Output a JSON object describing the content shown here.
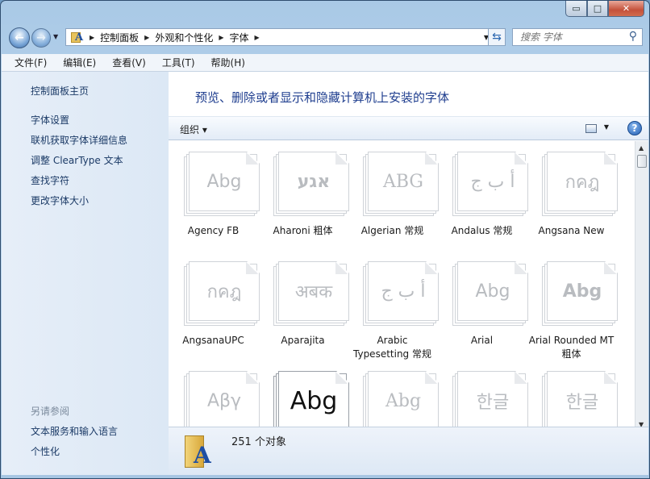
{
  "window": {
    "min_label": "▭",
    "max_label": "□",
    "close_label": "✕"
  },
  "address": {
    "crumbs": [
      "控制面板",
      "外观和个性化",
      "字体"
    ],
    "search_placeholder": "搜索 字体"
  },
  "menu": [
    "文件(F)",
    "编辑(E)",
    "查看(V)",
    "工具(T)",
    "帮助(H)"
  ],
  "sidebar": {
    "home": "控制面板主页",
    "links": [
      "字体设置",
      "联机获取字体详细信息",
      "调整 ClearType 文本",
      "查找字符",
      "更改字体大小"
    ],
    "see_also_title": "另请参阅",
    "see_also": [
      "文本服务和输入语言",
      "个性化"
    ]
  },
  "main": {
    "title": "预览、删除或者显示和隐藏计算机上安装的字体",
    "organize": "组织 ▾",
    "help": "?"
  },
  "fonts": [
    {
      "glyph": "Abg",
      "label": "Agency FB",
      "style": "sans"
    },
    {
      "glyph": "אגע",
      "label": "Aharoni 粗体",
      "style": "bold"
    },
    {
      "glyph": "ABG",
      "label": "Algerian 常规",
      "style": "serif"
    },
    {
      "glyph": "أ ب ج",
      "label": "Andalus 常规",
      "style": "serif"
    },
    {
      "glyph": "กคฎ",
      "label": "Angsana New",
      "style": "sans"
    },
    {
      "glyph": "กคฎ",
      "label": "AngsanaUPC",
      "style": "sans"
    },
    {
      "glyph": "अबक",
      "label": "Aparajita",
      "style": "serif"
    },
    {
      "glyph": "أ ب ج",
      "label": "Arabic Typesetting 常规",
      "style": "serif"
    },
    {
      "glyph": "Abg",
      "label": "Arial",
      "style": "sans"
    },
    {
      "glyph": "Abg",
      "label": "Arial Rounded MT 粗体",
      "style": "bold"
    },
    {
      "glyph": "Αβγ",
      "label": "",
      "style": "sans"
    },
    {
      "glyph": "Abg",
      "label": "",
      "style": "dark"
    },
    {
      "glyph": "Abg",
      "label": "",
      "style": "serif"
    },
    {
      "glyph": "한글",
      "label": "",
      "style": "sans"
    },
    {
      "glyph": "한글",
      "label": "",
      "style": "sans"
    }
  ],
  "details": {
    "count": "251 个对象"
  }
}
